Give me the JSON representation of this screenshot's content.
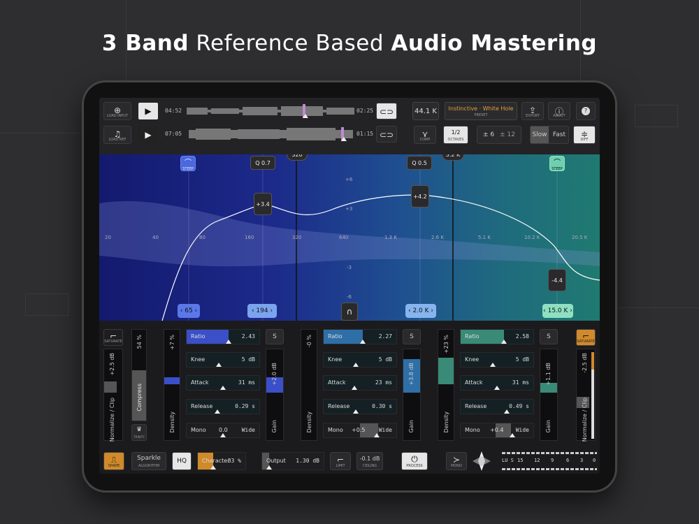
{
  "headline": {
    "part1": "3 Band",
    "part2": "Reference Based",
    "part3": "Audio Mastering"
  },
  "transport": {
    "load_input": "LOAD INPUT",
    "load_ref": "LOAD REF",
    "input_time_start": "04:52",
    "input_time_end": "02:25",
    "ref_time_start": "07:05",
    "ref_time_end": "01:15",
    "sample_rate": "44.1 K",
    "preset_name": "Instinctive · White Hole",
    "preset_label": "PRESET",
    "export_label": "EXPORT",
    "about_label": "ABOUT",
    "help": "?",
    "comp_label": "COMP",
    "octaves_value": "1/2",
    "octaves_label": "OCTAVES",
    "range_a": "± 6",
    "range_b": "± 12",
    "speed_slow": "Slow",
    "speed_fast": "Fast",
    "diff_label": "DIFF"
  },
  "eq": {
    "crossover_low": "320",
    "crossover_high": "3.2 K",
    "steep_label": "STEEP",
    "q_low": "Q 0.7",
    "q_high": "Q 0.5",
    "gain_low": "+3.4",
    "gain_high": "+4.2",
    "gain_right": "-4.4",
    "db_labels": [
      "+6",
      "+3",
      "-3",
      "-6"
    ],
    "freq_labels": [
      "20",
      "40",
      "80",
      "160",
      "320",
      "640",
      "1.3 K",
      "2.6 K",
      "5.1 K",
      "10.2 K",
      "20.5 K"
    ],
    "freq_btn_1": "65",
    "freq_btn_2": "194",
    "freq_btn_3": "2.0 K",
    "freq_btn_4": "15.0 K"
  },
  "bands": [
    {
      "density": "+7 %",
      "ratio": "2.43",
      "knee": "5 dB",
      "attack": "31 ms",
      "release": "0.29 s",
      "mono": "0.0",
      "gain": "+2.0 dB"
    },
    {
      "density": "-0 %",
      "ratio": "2.27",
      "knee": "5 dB",
      "attack": "23 ms",
      "release": "0.30 s",
      "mono": "+0.5",
      "gain": "+3.8 dB"
    },
    {
      "density": "+23 %",
      "ratio": "2.58",
      "knee": "5 dB",
      "attack": "31 ms",
      "release": "0.49 s",
      "mono": "+0.4",
      "gain": "+1.1 dB"
    }
  ],
  "band_labels": {
    "ratio": "Ratio",
    "knee": "Knee",
    "attack": "Attack",
    "release": "Release",
    "mono": "Mono",
    "wide": "Wide",
    "density": "Density",
    "gain": "Gain",
    "solo": "S"
  },
  "left_panel": {
    "saturate": "SATURATE",
    "input_db": "+2.5 dB",
    "compress_pct": "54 %",
    "compress": "Compress",
    "normalize": "Normalize / Clip",
    "trinity": "TRINITY"
  },
  "right_panel": {
    "saturate": "SATURATE",
    "output_db": "-2.5 dB",
    "normalize": "Normalize / Clip"
  },
  "footer": {
    "shape": "SHAPE",
    "algorithm_value": "Sparkle",
    "algorithm_label": "ALGORITHM",
    "hq": "HQ",
    "character": "Character",
    "character_value": "33 %",
    "output": "Output",
    "output_value": "1.30 dB",
    "limit": "LIMIT",
    "ceiling_value": "-0.1 dB",
    "ceiling_label": "CEILING",
    "process": "PROCESS",
    "mono": "MONO",
    "meter_scale": [
      "LU S",
      "15",
      "12",
      "9",
      "6",
      "3",
      "0"
    ]
  },
  "colors": {
    "band_low": "#3a4fc8",
    "band_mid": "#2f6fa8",
    "band_high": "#3a8a78",
    "accent_orange": "#d08a2a"
  }
}
